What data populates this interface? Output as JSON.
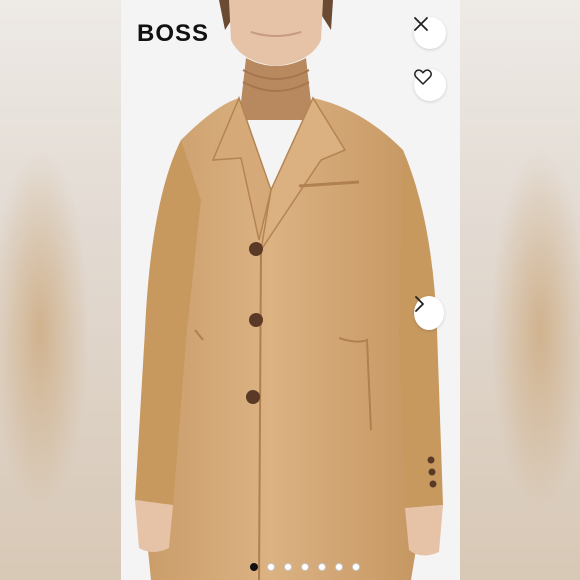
{
  "brand": {
    "logo_text": "BOSS"
  },
  "buttons": {
    "close_icon": "close-icon",
    "wishlist_icon": "heart-icon",
    "next_icon": "chevron-right-icon"
  },
  "carousel": {
    "total_images": 7,
    "active_index": 0
  },
  "colors": {
    "coat": "#d2a877",
    "turtleneck": "#b8895e",
    "background": "#f4f4f4"
  }
}
